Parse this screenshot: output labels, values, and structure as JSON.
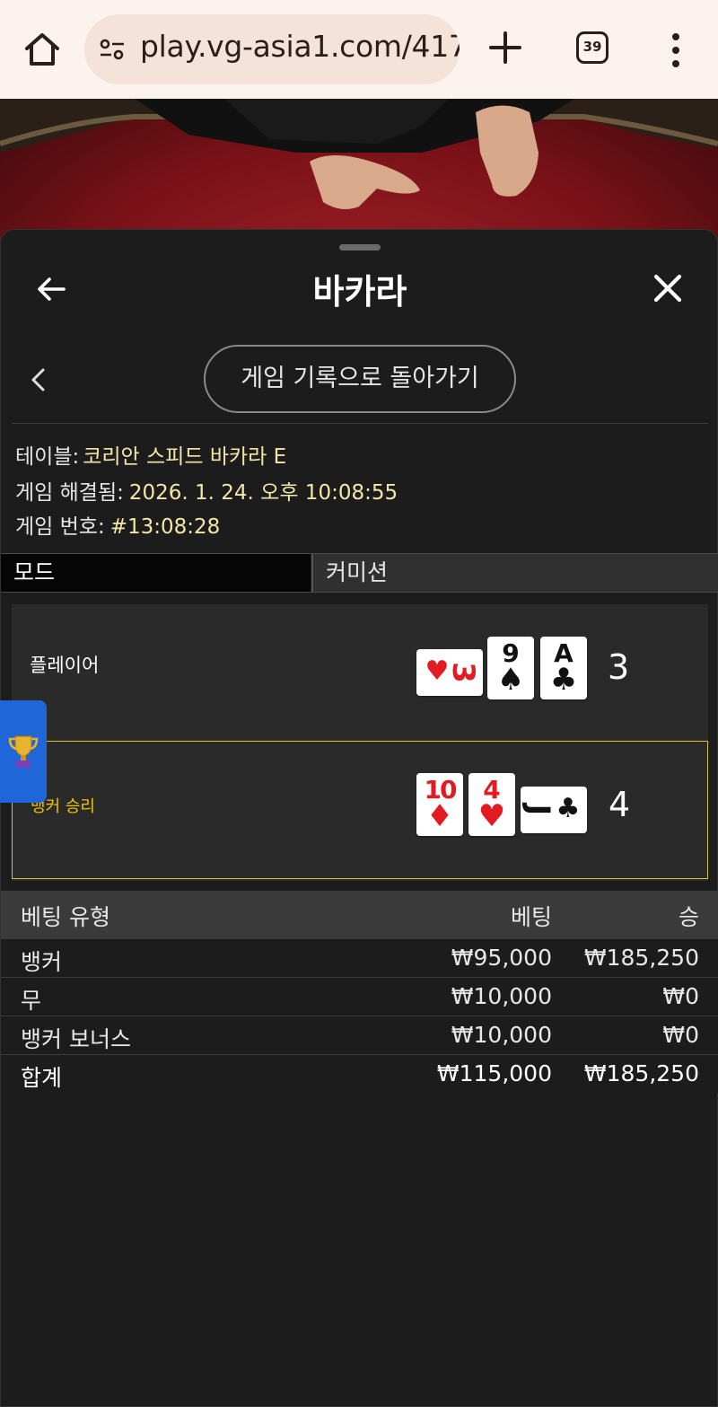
{
  "browser": {
    "url": "play.vg-asia1.com/417",
    "tab_count": "39",
    "icons": [
      "home-icon",
      "site-settings-icon",
      "new-tab-plus-icon",
      "tab-switcher-icon",
      "more-vert-icon"
    ]
  },
  "panel": {
    "title": "바카라",
    "history_button": "게임 기록으로 돌아가기"
  },
  "info": {
    "table_label": "테이블:",
    "table_value": "코리안 스피드 바카라 E",
    "resolved_label": "게임 해결됨:",
    "resolved_value": "2026. 1. 24. 오후 10:08:55",
    "number_label": "게임 번호:",
    "number_value": "#13:08:28"
  },
  "mode": {
    "key": "모드",
    "value": "커미션"
  },
  "hands": {
    "player": {
      "label": "플레이어",
      "score": "3",
      "cards": [
        {
          "rank": "3",
          "suit": "hearts",
          "orientation": "sideways"
        },
        {
          "rank": "9",
          "suit": "spades",
          "orientation": "upright"
        },
        {
          "rank": "A",
          "suit": "clubs",
          "orientation": "upright"
        }
      ]
    },
    "banker": {
      "label": "뱅커 승리",
      "score": "4",
      "winner": true,
      "cards": [
        {
          "rank": "10",
          "suit": "diamonds",
          "orientation": "upright"
        },
        {
          "rank": "4",
          "suit": "hearts",
          "orientation": "upright"
        },
        {
          "rank": "J",
          "suit": "clubs",
          "orientation": "sideways"
        }
      ]
    }
  },
  "bets": {
    "header": {
      "type": "베팅 유형",
      "bet": "베팅",
      "win": "승"
    },
    "rows": [
      {
        "type": "뱅커",
        "bet": "₩95,000",
        "win": "₩185,250"
      },
      {
        "type": "무",
        "bet": "₩10,000",
        "win": "₩0"
      },
      {
        "type": "뱅커 보너스",
        "bet": "₩10,000",
        "win": "₩0"
      }
    ],
    "total": {
      "type": "합계",
      "bet": "₩115,000",
      "win": "₩185,250"
    }
  },
  "colors": {
    "panel_bg": "#1c1c1c",
    "highlight_value": "#f5e6a8",
    "win_border": "#d8c227",
    "win_label": "#f0c400",
    "card_red": "#e21b22",
    "trophy_tab": "#1f66d8"
  }
}
